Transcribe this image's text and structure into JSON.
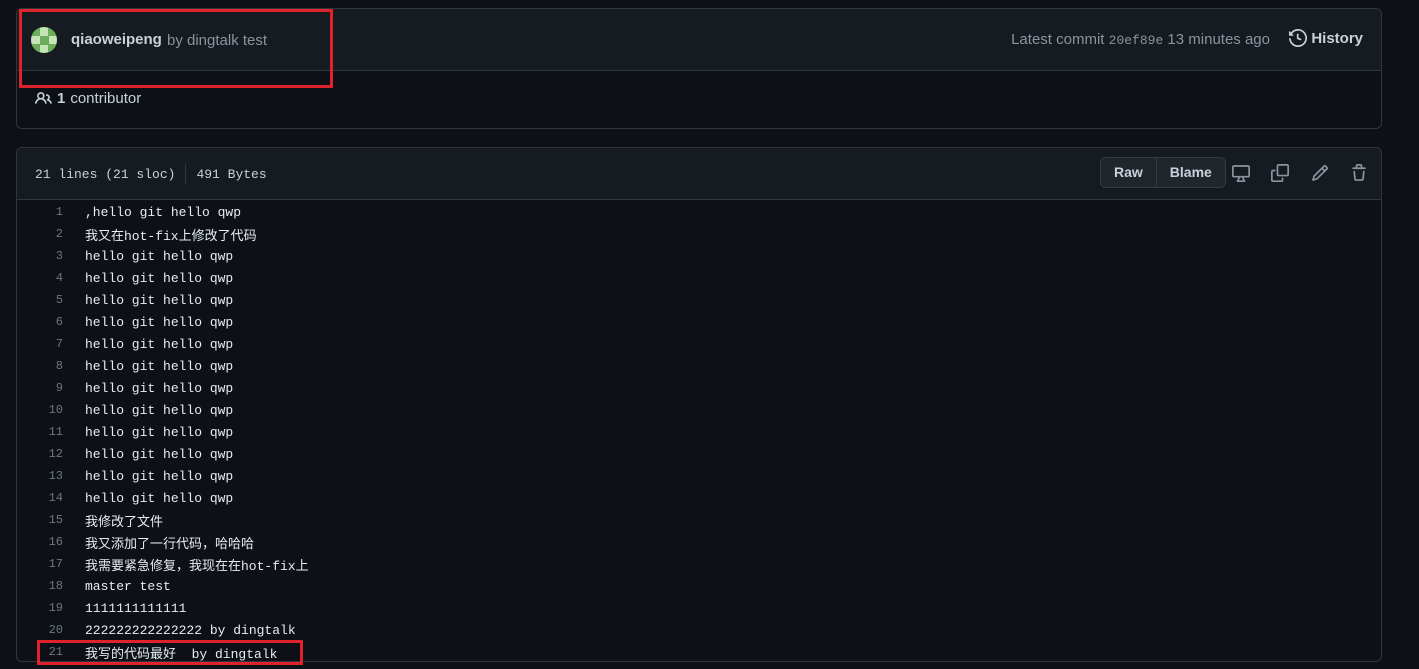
{
  "commit": {
    "author": "qiaoweipeng",
    "by_text": "by dingtalk test",
    "latest_label": "Latest commit",
    "sha": "20ef89e",
    "time": "13 minutes ago",
    "history_label": "History",
    "contributors_count": "1",
    "contributors_label": "contributor"
  },
  "file": {
    "lines_info": "21 lines (21 sloc)",
    "size": "491 Bytes",
    "raw_label": "Raw",
    "blame_label": "Blame",
    "icons": [
      "desktop-icon",
      "copy-icon",
      "pencil-icon",
      "trash-icon"
    ]
  },
  "code_lines": [
    {
      "n": "1",
      "text": ",hello git hello qwp"
    },
    {
      "n": "2",
      "text": "我又在hot-fix上修改了代码"
    },
    {
      "n": "3",
      "text": "hello git hello qwp"
    },
    {
      "n": "4",
      "text": "hello git hello qwp"
    },
    {
      "n": "5",
      "text": "hello git hello qwp"
    },
    {
      "n": "6",
      "text": "hello git hello qwp"
    },
    {
      "n": "7",
      "text": "hello git hello qwp"
    },
    {
      "n": "8",
      "text": "hello git hello qwp"
    },
    {
      "n": "9",
      "text": "hello git hello qwp"
    },
    {
      "n": "10",
      "text": "hello git hello qwp"
    },
    {
      "n": "11",
      "text": "hello git hello qwp"
    },
    {
      "n": "12",
      "text": "hello git hello qwp"
    },
    {
      "n": "13",
      "text": "hello git hello qwp"
    },
    {
      "n": "14",
      "text": "hello git hello qwp"
    },
    {
      "n": "15",
      "text": "我修改了文件"
    },
    {
      "n": "16",
      "text": "我又添加了一行代码，哈哈哈"
    },
    {
      "n": "17",
      "text": "我需要紧急修复，我现在在hot-fix上"
    },
    {
      "n": "18",
      "text": "master test"
    },
    {
      "n": "19",
      "text": "1111111111111"
    },
    {
      "n": "20",
      "text": "222222222222222 by dingtalk"
    },
    {
      "n": "21",
      "text": "我写的代码最好  by dingtalk"
    }
  ],
  "colors": {
    "background": "#0d1117",
    "border": "#30363d",
    "highlight_box": "#e0222b"
  }
}
